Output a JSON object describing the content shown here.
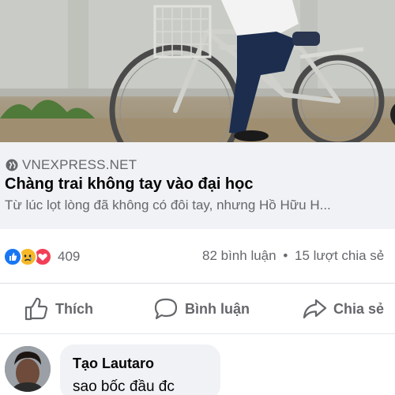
{
  "post": {
    "image": {
      "description_icon": "bicycle-photo"
    },
    "link_preview": {
      "source_icon": "globe-icon",
      "source": "VNEXPRESS.NET",
      "headline": "Chàng trai không tay vào đại học",
      "summary": "Từ lúc lọt lòng đã không có đôi tay, nhưng Hồ Hữu H..."
    },
    "reactions": {
      "icons": [
        "like-reaction-icon",
        "sad-reaction-icon",
        "love-reaction-icon"
      ],
      "count": "409",
      "comments": "82 bình luận",
      "separator": "•",
      "shares": "15 lượt chia sẻ"
    },
    "actions": {
      "like_label": "Thích",
      "comment_label": "Bình luận",
      "share_label": "Chia sẻ"
    }
  },
  "comment": {
    "author": "Tạo Lautaro",
    "text": "sao bốc đầu đc"
  },
  "colors": {
    "like_blue": "#1877f2",
    "love_red": "#f33e58",
    "sad_yellow": "#f7b928",
    "secondary_text": "#65676b",
    "preview_bg": "#f0f2f5"
  }
}
